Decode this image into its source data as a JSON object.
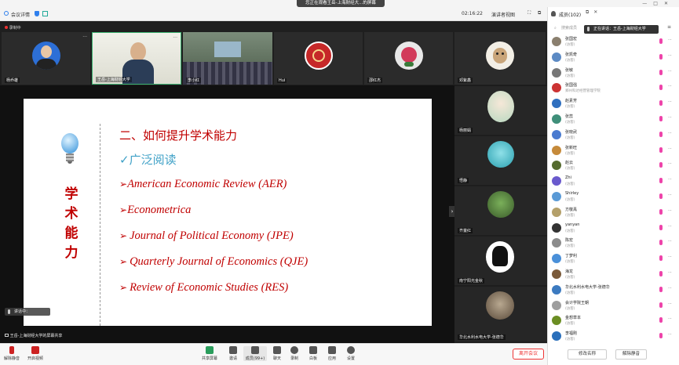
{
  "topbar": {
    "meeting_details": "会议详情",
    "share_banner": "您正在观看王岳-上海财经大...的屏幕",
    "timer": "02:16:22",
    "view_mode": "演讲者视图",
    "members_tab": "成员(102)"
  },
  "recording": {
    "label": "录制中"
  },
  "video_strip": [
    {
      "name": "杨乔雄"
    },
    {
      "name": "王岳-上海财经大学"
    },
    {
      "name": "李小红"
    },
    {
      "name": "Hui"
    },
    {
      "name": "邵红杰"
    },
    {
      "name": "邓紫鑫"
    }
  ],
  "slide": {
    "vertical_title": [
      "学",
      "术",
      "能",
      "力"
    ],
    "heading": "二、如何提升学术能力",
    "subheading": "✓广泛阅读",
    "journals": [
      "American Economic Review (AER)",
      "Econometrica",
      "Journal of Political Economy (JPE)",
      "Quarterly Journal of Economics (QJE)",
      "Review of Economic Studies (RES)"
    ]
  },
  "right_tiles": [
    {
      "name": "杨丽娟"
    },
    {
      "name": "悟静"
    },
    {
      "name": "齐童红"
    },
    {
      "name": "南宁阳光金秋"
    },
    {
      "name": "华北水利水电大学-张德华"
    }
  ],
  "speaking": "讲话中：",
  "screen_share_label": "王岳-上海财经大学的屏幕共享",
  "toolbar": {
    "mute": "解除静音",
    "video": "开启视频",
    "share": "共享屏幕",
    "invite": "邀请",
    "members": "成员(99+)",
    "chat": "聊天",
    "record": "录制",
    "whiteboard": "白板",
    "apps": "应用",
    "settings": "设置",
    "end": "离开会议"
  },
  "panel": {
    "search_placeholder": "搜索成员",
    "tooltip": "正在讲话：王岳-上海财经大学",
    "invite_button": "修改名称",
    "mute_all_button": "解除静音",
    "members": [
      {
        "name": "张国宏",
        "role": "(访客)",
        "color": "#8a7f6e"
      },
      {
        "name": "张凯奇",
        "role": "(访客)",
        "color": "#5c8ac4"
      },
      {
        "name": "张敏",
        "role": "(访客)",
        "color": "#777777"
      },
      {
        "name": "张国强",
        "role": "郑州科达经营管理学院",
        "color": "#c33"
      },
      {
        "name": "赵素芳",
        "role": "(访客)",
        "color": "#2f6fbf"
      },
      {
        "name": "张蕊",
        "role": "(访客)",
        "color": "#3f8f7a"
      },
      {
        "name": "张晓武",
        "role": "(访客)",
        "color": "#4a7bd0"
      },
      {
        "name": "张新旺",
        "role": "(访客)",
        "color": "#c68a3a"
      },
      {
        "name": "赵云",
        "role": "(访客)",
        "color": "#556b2f"
      },
      {
        "name": "Zhi",
        "role": "(访客)",
        "color": "#6a5acd"
      },
      {
        "name": "Shirley",
        "role": "(访客)",
        "color": "#5a9ad6"
      },
      {
        "name": "方敬禹",
        "role": "(访客)",
        "color": "#b4a06a"
      },
      {
        "name": "yanyan",
        "role": "(访客)",
        "color": "#333333"
      },
      {
        "name": "陈宏",
        "role": "(访客)",
        "color": "#8c8c8c"
      },
      {
        "name": "丁梦利",
        "role": "(访客)",
        "color": "#4a90d9"
      },
      {
        "name": "海龙",
        "role": "(访客)",
        "color": "#7a5a3a"
      },
      {
        "name": "华北水利水电大学-张德华",
        "role": "(访客)",
        "color": "#3c7ac0"
      },
      {
        "name": "会计学院王朝",
        "role": "(访客)",
        "color": "#9e9e9e"
      },
      {
        "name": "金想草本",
        "role": "(访客)",
        "color": "#6b8e23"
      },
      {
        "name": "李福刚",
        "role": "(访客)",
        "color": "#2a6fbb"
      }
    ]
  }
}
